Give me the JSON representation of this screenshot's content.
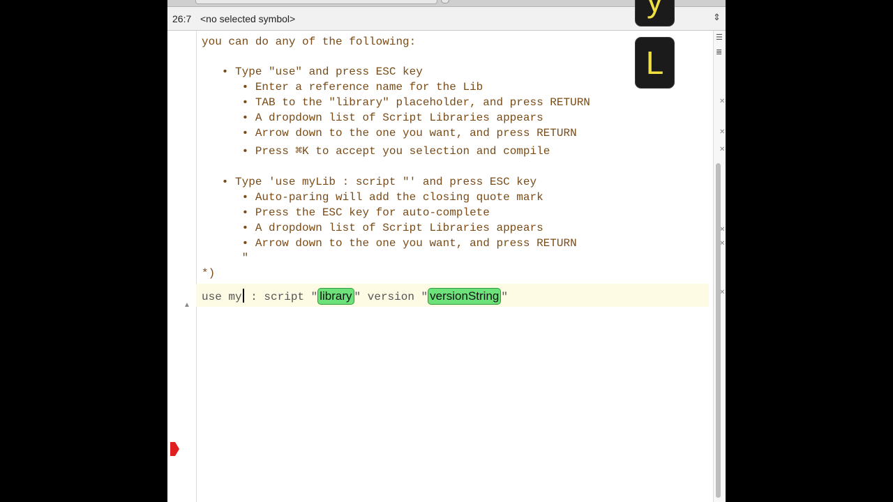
{
  "navbar": {
    "position": "26:7",
    "symbol": "<no selected symbol>"
  },
  "keys": [
    "y",
    "L"
  ],
  "comment_lines": [
    "you can do any of the following:",
    "",
    "   • Type \"use\" and press ESC key",
    "      • Enter a reference name for the Lib",
    "      • TAB to the \"library\" placeholder, and press RETURN",
    "      • A dropdown list of Script Libraries appears",
    "      • Arrow down to the one you want, and press RETURN",
    "      • Press ⌘K to accept you selection and compile",
    "",
    "   • Type 'use myLib : script \"' and press ESC key",
    "      • Auto-paring will add the closing quote mark",
    "      • Press the ESC key for auto-complete",
    "      • A dropdown list of Script Libraries appears",
    "      • Arrow down to the one you want, and press RETURN",
    "      \"",
    "*)"
  ],
  "code": {
    "before_caret": "use my",
    "after_caret": " : script \"",
    "placeholder_library": "library",
    "middle": "\" version \"",
    "placeholder_version": "versionString",
    "end": "\""
  }
}
